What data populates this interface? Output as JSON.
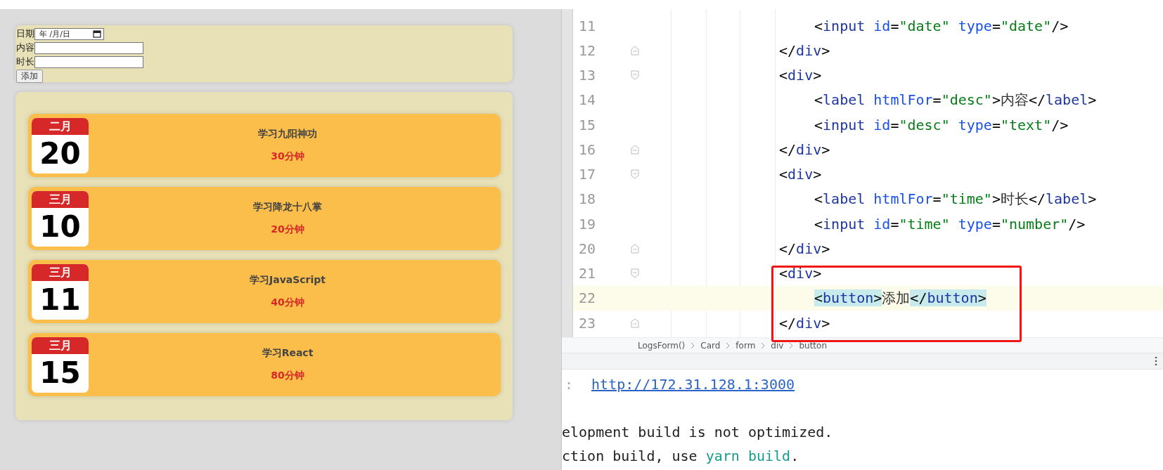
{
  "form": {
    "fields": [
      {
        "kind": "date",
        "label": "日期",
        "placeholder": "年 /月/日"
      },
      {
        "kind": "text",
        "label": "内容"
      },
      {
        "kind": "text",
        "label": "时长"
      }
    ],
    "submit": "添加"
  },
  "logs": [
    {
      "month": "二月",
      "day": "20",
      "desc": "学习九阳神功",
      "time": "30分钟"
    },
    {
      "month": "三月",
      "day": "10",
      "desc": "学习降龙十八掌",
      "time": "20分钟"
    },
    {
      "month": "三月",
      "day": "11",
      "desc": "学习JavaScript",
      "time": "40分钟"
    },
    {
      "month": "三月",
      "day": "15",
      "desc": "学习React",
      "time": "80分钟"
    }
  ],
  "editor": {
    "lines": [
      {
        "number": "11",
        "fold_start": false,
        "fold_end": false,
        "nested": true,
        "current": false,
        "matched": false,
        "boxed": false,
        "tokens": [
          {
            "kind": "punct",
            "text": "<"
          },
          {
            "kind": "tag",
            "text": "input"
          },
          {
            "kind": "attr",
            "text": " id"
          },
          {
            "kind": "punct",
            "text": "="
          },
          {
            "kind": "string",
            "text": "\"date\""
          },
          {
            "kind": "attr",
            "text": " type"
          },
          {
            "kind": "punct",
            "text": "="
          },
          {
            "kind": "string",
            "text": "\"date\""
          },
          {
            "kind": "punct",
            "text": "/>"
          }
        ]
      },
      {
        "number": "12",
        "fold_start": false,
        "fold_end": true,
        "nested": false,
        "current": false,
        "matched": false,
        "boxed": false,
        "tokens": [
          {
            "kind": "punct",
            "text": "</"
          },
          {
            "kind": "tag",
            "text": "div"
          },
          {
            "kind": "punct",
            "text": ">"
          }
        ]
      },
      {
        "number": "13",
        "fold_start": true,
        "fold_end": false,
        "nested": false,
        "current": false,
        "matched": false,
        "boxed": false,
        "tokens": [
          {
            "kind": "punct",
            "text": "<"
          },
          {
            "kind": "tag",
            "text": "div"
          },
          {
            "kind": "punct",
            "text": ">"
          }
        ]
      },
      {
        "number": "14",
        "fold_start": false,
        "fold_end": false,
        "nested": true,
        "current": false,
        "matched": false,
        "boxed": false,
        "tokens": [
          {
            "kind": "punct",
            "text": "<"
          },
          {
            "kind": "tag",
            "text": "label"
          },
          {
            "kind": "attr",
            "text": " htmlFor"
          },
          {
            "kind": "punct",
            "text": "="
          },
          {
            "kind": "string",
            "text": "\"desc\""
          },
          {
            "kind": "punct",
            "text": ">"
          },
          {
            "kind": "text",
            "text": "内容"
          },
          {
            "kind": "punct",
            "text": "</"
          },
          {
            "kind": "tag",
            "text": "label"
          },
          {
            "kind": "punct",
            "text": ">"
          }
        ]
      },
      {
        "number": "15",
        "fold_start": false,
        "fold_end": false,
        "nested": true,
        "current": false,
        "matched": false,
        "boxed": false,
        "tokens": [
          {
            "kind": "punct",
            "text": "<"
          },
          {
            "kind": "tag",
            "text": "input"
          },
          {
            "kind": "attr",
            "text": " id"
          },
          {
            "kind": "punct",
            "text": "="
          },
          {
            "kind": "string",
            "text": "\"desc\""
          },
          {
            "kind": "attr",
            "text": " type"
          },
          {
            "kind": "punct",
            "text": "="
          },
          {
            "kind": "string",
            "text": "\"text\""
          },
          {
            "kind": "punct",
            "text": "/>"
          }
        ]
      },
      {
        "number": "16",
        "fold_start": false,
        "fold_end": true,
        "nested": false,
        "current": false,
        "matched": false,
        "boxed": false,
        "tokens": [
          {
            "kind": "punct",
            "text": "</"
          },
          {
            "kind": "tag",
            "text": "div"
          },
          {
            "kind": "punct",
            "text": ">"
          }
        ]
      },
      {
        "number": "17",
        "fold_start": true,
        "fold_end": false,
        "nested": false,
        "current": false,
        "matched": false,
        "boxed": false,
        "tokens": [
          {
            "kind": "punct",
            "text": "<"
          },
          {
            "kind": "tag",
            "text": "div"
          },
          {
            "kind": "punct",
            "text": ">"
          }
        ]
      },
      {
        "number": "18",
        "fold_start": false,
        "fold_end": false,
        "nested": true,
        "current": false,
        "matched": false,
        "boxed": false,
        "tokens": [
          {
            "kind": "punct",
            "text": "<"
          },
          {
            "kind": "tag",
            "text": "label"
          },
          {
            "kind": "attr",
            "text": " htmlFor"
          },
          {
            "kind": "punct",
            "text": "="
          },
          {
            "kind": "string",
            "text": "\"time\""
          },
          {
            "kind": "punct",
            "text": ">"
          },
          {
            "kind": "text",
            "text": "时长"
          },
          {
            "kind": "punct",
            "text": "</"
          },
          {
            "kind": "tag",
            "text": "label"
          },
          {
            "kind": "punct",
            "text": ">"
          }
        ]
      },
      {
        "number": "19",
        "fold_start": false,
        "fold_end": false,
        "nested": true,
        "current": false,
        "matched": false,
        "boxed": false,
        "tokens": [
          {
            "kind": "punct",
            "text": "<"
          },
          {
            "kind": "tag",
            "text": "input"
          },
          {
            "kind": "attr",
            "text": " id"
          },
          {
            "kind": "punct",
            "text": "="
          },
          {
            "kind": "string",
            "text": "\"time\""
          },
          {
            "kind": "attr",
            "text": " type"
          },
          {
            "kind": "punct",
            "text": "="
          },
          {
            "kind": "string",
            "text": "\"number\""
          },
          {
            "kind": "punct",
            "text": "/>"
          }
        ]
      },
      {
        "number": "20",
        "fold_start": false,
        "fold_end": true,
        "nested": false,
        "current": false,
        "matched": false,
        "boxed": false,
        "tokens": [
          {
            "kind": "punct",
            "text": "</"
          },
          {
            "kind": "tag",
            "text": "div"
          },
          {
            "kind": "punct",
            "text": ">"
          }
        ]
      },
      {
        "number": "21",
        "fold_start": true,
        "fold_end": false,
        "nested": false,
        "current": false,
        "matched": false,
        "boxed": true,
        "tokens": [
          {
            "kind": "punct",
            "text": "<"
          },
          {
            "kind": "tag",
            "text": "div"
          },
          {
            "kind": "punct",
            "text": ">"
          }
        ]
      },
      {
        "number": "22",
        "fold_start": false,
        "fold_end": false,
        "nested": true,
        "current": true,
        "matched": true,
        "boxed": true,
        "tokens": [
          {
            "kind": "punct",
            "text": "<"
          },
          {
            "kind": "tag",
            "text": "button"
          },
          {
            "kind": "punct",
            "text": ">"
          },
          {
            "kind": "text",
            "text": "添加"
          },
          {
            "kind": "punct",
            "text": "</"
          },
          {
            "kind": "tag",
            "text": "button"
          },
          {
            "kind": "punct",
            "text": ">"
          }
        ]
      },
      {
        "number": "23",
        "fold_start": false,
        "fold_end": true,
        "nested": false,
        "current": false,
        "matched": false,
        "boxed": true,
        "tokens": [
          {
            "kind": "punct",
            "text": "</"
          },
          {
            "kind": "tag",
            "text": "div"
          },
          {
            "kind": "punct",
            "text": ">"
          }
        ]
      }
    ],
    "breadcrumb": [
      "LogsForm()",
      "Card",
      "form",
      "div",
      "button"
    ]
  },
  "terminal": {
    "prefix": ":",
    "url": "http://172.31.128.1:3000",
    "lines": [
      {
        "segments": [
          {
            "kind": "text",
            "text": "elopment build is not optimized."
          }
        ]
      },
      {
        "segments": [
          {
            "kind": "text",
            "text": "ction build, use "
          },
          {
            "kind": "command",
            "text": "yarn build"
          },
          {
            "kind": "text",
            "text": "."
          }
        ]
      }
    ]
  }
}
